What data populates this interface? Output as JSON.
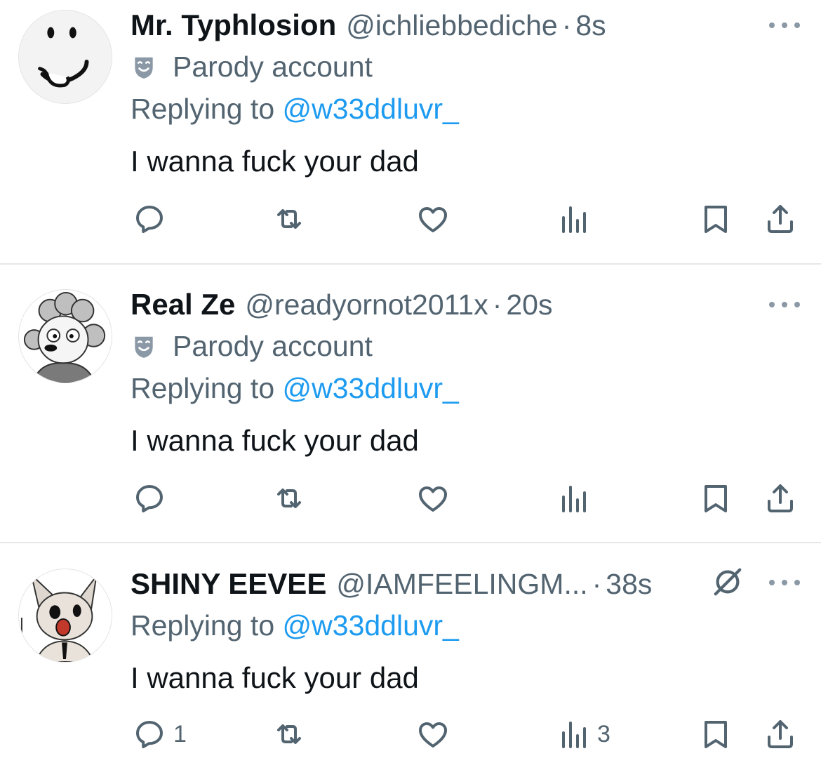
{
  "tweets": [
    {
      "name": "Mr. Typhlosion",
      "handle": "@ichliebbediche",
      "dot": "·",
      "time": "8s",
      "parody_label": "Parody account",
      "replying_prefix": "Replying to",
      "replying_to": "@w33ddluvr_",
      "text": "I wanna fuck your dad",
      "reply_count": "",
      "views_count": ""
    },
    {
      "name": "Real Ze",
      "handle": "@readyornot2011x",
      "dot": "·",
      "time": "20s",
      "parody_label": "Parody account",
      "replying_prefix": "Replying to",
      "replying_to": "@w33ddluvr_",
      "text": "I wanna fuck your dad",
      "reply_count": "",
      "views_count": ""
    },
    {
      "name": "SHINY EEVEE",
      "handle": "@IAMFEELINGM...",
      "dot": "·",
      "time": "38s",
      "replying_prefix": "Replying to",
      "replying_to": "@w33ddluvr_",
      "text": "I wanna fuck your dad",
      "reply_count": "1",
      "views_count": "3"
    }
  ],
  "colors": {
    "text": "#0f1419",
    "secondary": "#536471",
    "link": "#1d9bf0",
    "divider": "#e5e7e9"
  },
  "icons": [
    "reply-icon",
    "retweet-icon",
    "like-icon",
    "views-icon",
    "bookmark-icon",
    "share-icon",
    "more-icon",
    "parody-mask-icon",
    "blocked-icon"
  ]
}
